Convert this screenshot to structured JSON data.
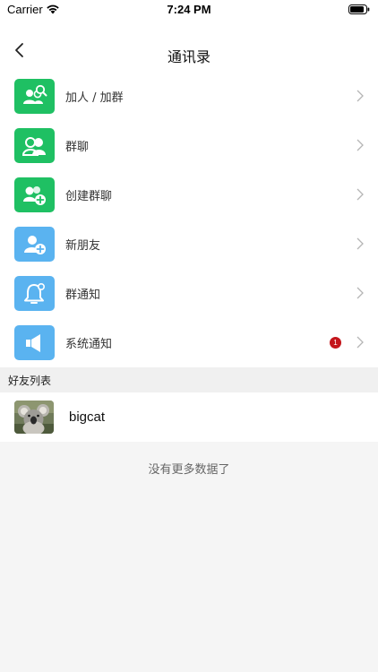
{
  "status_bar": {
    "carrier": "Carrier",
    "time": "7:24 PM"
  },
  "nav": {
    "title": "通讯录",
    "back_icon": "chevron-left-icon"
  },
  "menu": {
    "items": [
      {
        "label": "加人 / 加群",
        "icon": "add-friend-search-icon",
        "color": "#1fc063"
      },
      {
        "label": "群聊",
        "icon": "group-chat-icon",
        "color": "#1fc063"
      },
      {
        "label": "创建群聊",
        "icon": "create-group-icon",
        "color": "#1fc063"
      },
      {
        "label": "新朋友",
        "icon": "new-friend-icon",
        "color": "#5ab3f0"
      },
      {
        "label": "群通知",
        "icon": "bell-icon",
        "color": "#5ab3f0"
      },
      {
        "label": "系统通知",
        "icon": "speaker-icon",
        "color": "#5ab3f0",
        "badge": "1"
      }
    ]
  },
  "friends": {
    "section_title": "好友列表",
    "items": [
      {
        "name": "bigcat",
        "avatar": "koala-avatar"
      }
    ],
    "no_more_text": "没有更多数据了"
  },
  "colors": {
    "green": "#1fc063",
    "blue": "#5ab3f0",
    "badge": "#c4161c",
    "background": "#f5f5f5"
  }
}
